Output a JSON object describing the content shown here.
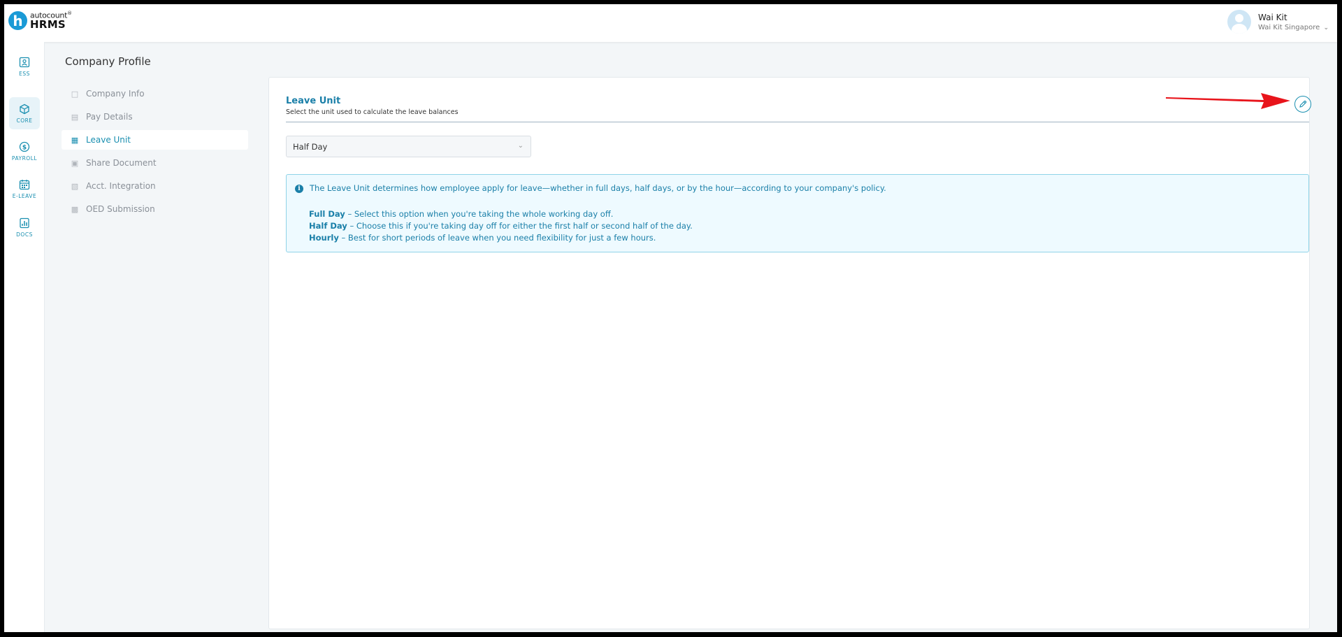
{
  "header": {
    "logo_letter": "h",
    "logo_top": "autocount",
    "logo_tm": "®",
    "logo_bottom": "HRMS",
    "user_name": "Wai Kit",
    "user_company": "Wai Kit Singapore"
  },
  "rail": {
    "items": [
      {
        "label": "ESS",
        "icon": "id-card-icon"
      },
      {
        "label": "CORE",
        "icon": "cube-icon"
      },
      {
        "label": "PAYROLL",
        "icon": "dollar-icon"
      },
      {
        "label": "E-LEAVE",
        "icon": "calendar-icon"
      },
      {
        "label": "DOCS",
        "icon": "chart-doc-icon"
      }
    ],
    "active": "CORE"
  },
  "page": {
    "title": "Company Profile"
  },
  "subnav": {
    "items": [
      {
        "label": "Company Info",
        "icon": "building-icon"
      },
      {
        "label": "Pay Details",
        "icon": "receipt-icon"
      },
      {
        "label": "Leave Unit",
        "icon": "calendar-clock-icon"
      },
      {
        "label": "Share Document",
        "icon": "document-share-icon"
      },
      {
        "label": "Acct. Integration",
        "icon": "integration-icon"
      },
      {
        "label": "OED Submission",
        "icon": "submission-icon"
      }
    ],
    "active": "Leave Unit"
  },
  "card": {
    "title": "Leave Unit",
    "subtitle": "Select the unit used to calculate the leave balances",
    "select_value": "Half Day",
    "info": {
      "intro": "The Leave Unit determines how employee apply for leave—whether in full days, half days, or by the hour—according to your company's policy.",
      "lines": [
        {
          "term": "Full Day",
          "text": " – Select this option when you're taking the whole working day off."
        },
        {
          "term": "Half Day",
          "text": " – Choose this if you're taking day off for either the first half or second half of the day."
        },
        {
          "term": "Hourly",
          "text": " – Best for short periods of leave when you need flexibility for just a few hours."
        }
      ]
    }
  },
  "colors": {
    "accent": "#1a8fb0",
    "info_border": "#8fd3e8",
    "info_bg": "#eefaff",
    "arrow": "#e8141b"
  }
}
